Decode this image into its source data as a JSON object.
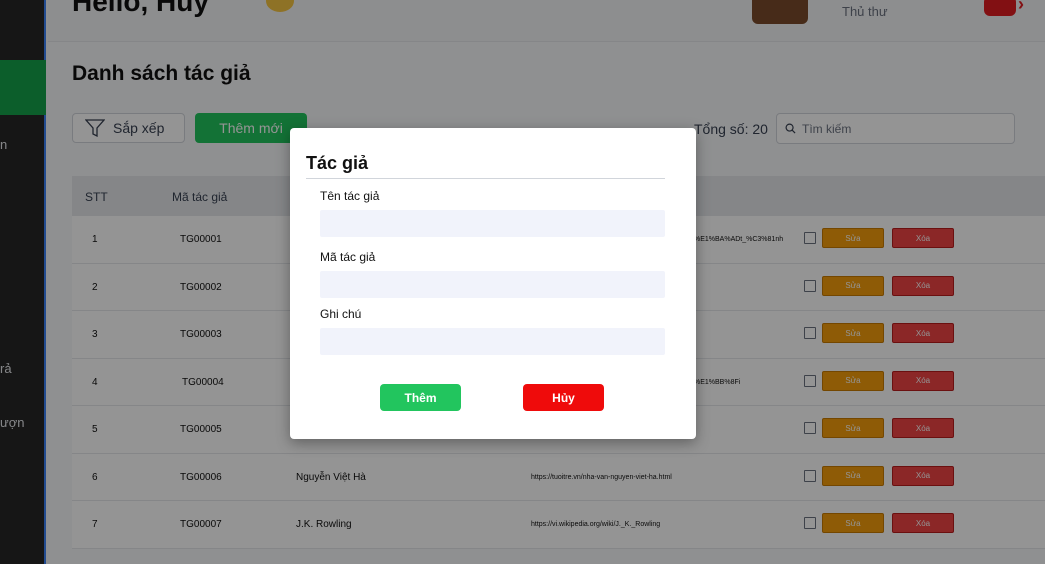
{
  "sidebar": {
    "fragments": [
      "n",
      "rả",
      "ượn"
    ]
  },
  "header": {
    "greeting": "Hello, Huy",
    "role": "Thủ thư"
  },
  "main": {
    "title": "Danh sách tác giả",
    "sort_label": "Sắp xếp",
    "add_label": "Thêm mới",
    "total_label": "Tổng số: 20",
    "search_placeholder": "Tìm kiếm"
  },
  "table": {
    "headers": [
      "STT",
      "Mã tác giả"
    ],
    "edit_label": "Sửa",
    "delete_label": "Xóa",
    "rows": [
      {
        "stt": "1",
        "code": "TG00001",
        "name": "",
        "link": "%E1%BA%ADt_%C3%81nh"
      },
      {
        "stt": "2",
        "code": "TG00002",
        "name": "",
        "link": ""
      },
      {
        "stt": "3",
        "code": "TG00003",
        "name": "",
        "link": ""
      },
      {
        "stt": "4",
        "code": "TG00004",
        "name": "",
        "link": "%E1%BB%8Fi"
      },
      {
        "stt": "5",
        "code": "TG00005",
        "name": "",
        "link": ""
      },
      {
        "stt": "6",
        "code": "TG00006",
        "name": "Nguyễn Việt Hà",
        "link": "https://tuoitre.vn/nha-van-nguyen-viet-ha.html"
      },
      {
        "stt": "7",
        "code": "TG00007",
        "name": "J.K. Rowling",
        "link": "https://vi.wikipedia.org/wiki/J._K._Rowling"
      }
    ]
  },
  "modal": {
    "title": "Tác giả",
    "name_label": "Tên tác giả",
    "code_label": "Mã tác giả",
    "note_label": "Ghi chú",
    "add_label": "Thêm",
    "cancel_label": "Hủy"
  },
  "colors": {
    "accent_green": "#22c55e",
    "danger_red": "#ef0b0b",
    "edit_orange": "#f59e0b"
  }
}
